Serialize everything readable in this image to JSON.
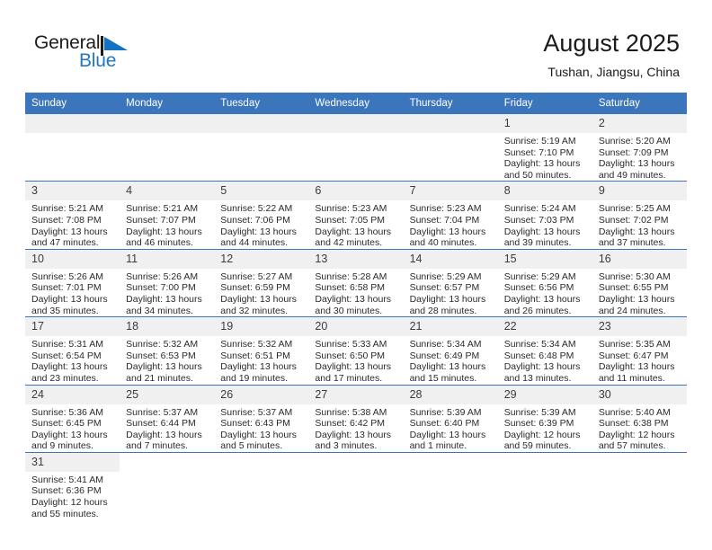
{
  "brand": {
    "name_part1": "General",
    "name_part2": "Blue",
    "flag_icon": "blue-triangle-flag-icon",
    "accent_color": "#2077c4"
  },
  "header": {
    "title": "August 2025",
    "subtitle": "Tushan, Jiangsu, China"
  },
  "theme": {
    "header_blue": "#3b76bc",
    "daynum_band": "#f0f0f0",
    "text": "#2a2a2a"
  },
  "calendar": {
    "weekday_headers": [
      "Sunday",
      "Monday",
      "Tuesday",
      "Wednesday",
      "Thursday",
      "Friday",
      "Saturday"
    ],
    "weeks": [
      [
        {
          "day": "",
          "sunrise": "",
          "sunset": "",
          "daylight_line1": "",
          "daylight_line2": ""
        },
        {
          "day": "",
          "sunrise": "",
          "sunset": "",
          "daylight_line1": "",
          "daylight_line2": ""
        },
        {
          "day": "",
          "sunrise": "",
          "sunset": "",
          "daylight_line1": "",
          "daylight_line2": ""
        },
        {
          "day": "",
          "sunrise": "",
          "sunset": "",
          "daylight_line1": "",
          "daylight_line2": ""
        },
        {
          "day": "",
          "sunrise": "",
          "sunset": "",
          "daylight_line1": "",
          "daylight_line2": ""
        },
        {
          "day": "1",
          "sunrise": "Sunrise: 5:19 AM",
          "sunset": "Sunset: 7:10 PM",
          "daylight_line1": "Daylight: 13 hours",
          "daylight_line2": "and 50 minutes."
        },
        {
          "day": "2",
          "sunrise": "Sunrise: 5:20 AM",
          "sunset": "Sunset: 7:09 PM",
          "daylight_line1": "Daylight: 13 hours",
          "daylight_line2": "and 49 minutes."
        }
      ],
      [
        {
          "day": "3",
          "sunrise": "Sunrise: 5:21 AM",
          "sunset": "Sunset: 7:08 PM",
          "daylight_line1": "Daylight: 13 hours",
          "daylight_line2": "and 47 minutes."
        },
        {
          "day": "4",
          "sunrise": "Sunrise: 5:21 AM",
          "sunset": "Sunset: 7:07 PM",
          "daylight_line1": "Daylight: 13 hours",
          "daylight_line2": "and 46 minutes."
        },
        {
          "day": "5",
          "sunrise": "Sunrise: 5:22 AM",
          "sunset": "Sunset: 7:06 PM",
          "daylight_line1": "Daylight: 13 hours",
          "daylight_line2": "and 44 minutes."
        },
        {
          "day": "6",
          "sunrise": "Sunrise: 5:23 AM",
          "sunset": "Sunset: 7:05 PM",
          "daylight_line1": "Daylight: 13 hours",
          "daylight_line2": "and 42 minutes."
        },
        {
          "day": "7",
          "sunrise": "Sunrise: 5:23 AM",
          "sunset": "Sunset: 7:04 PM",
          "daylight_line1": "Daylight: 13 hours",
          "daylight_line2": "and 40 minutes."
        },
        {
          "day": "8",
          "sunrise": "Sunrise: 5:24 AM",
          "sunset": "Sunset: 7:03 PM",
          "daylight_line1": "Daylight: 13 hours",
          "daylight_line2": "and 39 minutes."
        },
        {
          "day": "9",
          "sunrise": "Sunrise: 5:25 AM",
          "sunset": "Sunset: 7:02 PM",
          "daylight_line1": "Daylight: 13 hours",
          "daylight_line2": "and 37 minutes."
        }
      ],
      [
        {
          "day": "10",
          "sunrise": "Sunrise: 5:26 AM",
          "sunset": "Sunset: 7:01 PM",
          "daylight_line1": "Daylight: 13 hours",
          "daylight_line2": "and 35 minutes."
        },
        {
          "day": "11",
          "sunrise": "Sunrise: 5:26 AM",
          "sunset": "Sunset: 7:00 PM",
          "daylight_line1": "Daylight: 13 hours",
          "daylight_line2": "and 34 minutes."
        },
        {
          "day": "12",
          "sunrise": "Sunrise: 5:27 AM",
          "sunset": "Sunset: 6:59 PM",
          "daylight_line1": "Daylight: 13 hours",
          "daylight_line2": "and 32 minutes."
        },
        {
          "day": "13",
          "sunrise": "Sunrise: 5:28 AM",
          "sunset": "Sunset: 6:58 PM",
          "daylight_line1": "Daylight: 13 hours",
          "daylight_line2": "and 30 minutes."
        },
        {
          "day": "14",
          "sunrise": "Sunrise: 5:29 AM",
          "sunset": "Sunset: 6:57 PM",
          "daylight_line1": "Daylight: 13 hours",
          "daylight_line2": "and 28 minutes."
        },
        {
          "day": "15",
          "sunrise": "Sunrise: 5:29 AM",
          "sunset": "Sunset: 6:56 PM",
          "daylight_line1": "Daylight: 13 hours",
          "daylight_line2": "and 26 minutes."
        },
        {
          "day": "16",
          "sunrise": "Sunrise: 5:30 AM",
          "sunset": "Sunset: 6:55 PM",
          "daylight_line1": "Daylight: 13 hours",
          "daylight_line2": "and 24 minutes."
        }
      ],
      [
        {
          "day": "17",
          "sunrise": "Sunrise: 5:31 AM",
          "sunset": "Sunset: 6:54 PM",
          "daylight_line1": "Daylight: 13 hours",
          "daylight_line2": "and 23 minutes."
        },
        {
          "day": "18",
          "sunrise": "Sunrise: 5:32 AM",
          "sunset": "Sunset: 6:53 PM",
          "daylight_line1": "Daylight: 13 hours",
          "daylight_line2": "and 21 minutes."
        },
        {
          "day": "19",
          "sunrise": "Sunrise: 5:32 AM",
          "sunset": "Sunset: 6:51 PM",
          "daylight_line1": "Daylight: 13 hours",
          "daylight_line2": "and 19 minutes."
        },
        {
          "day": "20",
          "sunrise": "Sunrise: 5:33 AM",
          "sunset": "Sunset: 6:50 PM",
          "daylight_line1": "Daylight: 13 hours",
          "daylight_line2": "and 17 minutes."
        },
        {
          "day": "21",
          "sunrise": "Sunrise: 5:34 AM",
          "sunset": "Sunset: 6:49 PM",
          "daylight_line1": "Daylight: 13 hours",
          "daylight_line2": "and 15 minutes."
        },
        {
          "day": "22",
          "sunrise": "Sunrise: 5:34 AM",
          "sunset": "Sunset: 6:48 PM",
          "daylight_line1": "Daylight: 13 hours",
          "daylight_line2": "and 13 minutes."
        },
        {
          "day": "23",
          "sunrise": "Sunrise: 5:35 AM",
          "sunset": "Sunset: 6:47 PM",
          "daylight_line1": "Daylight: 13 hours",
          "daylight_line2": "and 11 minutes."
        }
      ],
      [
        {
          "day": "24",
          "sunrise": "Sunrise: 5:36 AM",
          "sunset": "Sunset: 6:45 PM",
          "daylight_line1": "Daylight: 13 hours",
          "daylight_line2": "and 9 minutes."
        },
        {
          "day": "25",
          "sunrise": "Sunrise: 5:37 AM",
          "sunset": "Sunset: 6:44 PM",
          "daylight_line1": "Daylight: 13 hours",
          "daylight_line2": "and 7 minutes."
        },
        {
          "day": "26",
          "sunrise": "Sunrise: 5:37 AM",
          "sunset": "Sunset: 6:43 PM",
          "daylight_line1": "Daylight: 13 hours",
          "daylight_line2": "and 5 minutes."
        },
        {
          "day": "27",
          "sunrise": "Sunrise: 5:38 AM",
          "sunset": "Sunset: 6:42 PM",
          "daylight_line1": "Daylight: 13 hours",
          "daylight_line2": "and 3 minutes."
        },
        {
          "day": "28",
          "sunrise": "Sunrise: 5:39 AM",
          "sunset": "Sunset: 6:40 PM",
          "daylight_line1": "Daylight: 13 hours",
          "daylight_line2": "and 1 minute."
        },
        {
          "day": "29",
          "sunrise": "Sunrise: 5:39 AM",
          "sunset": "Sunset: 6:39 PM",
          "daylight_line1": "Daylight: 12 hours",
          "daylight_line2": "and 59 minutes."
        },
        {
          "day": "30",
          "sunrise": "Sunrise: 5:40 AM",
          "sunset": "Sunset: 6:38 PM",
          "daylight_line1": "Daylight: 12 hours",
          "daylight_line2": "and 57 minutes."
        }
      ],
      [
        {
          "day": "31",
          "sunrise": "Sunrise: 5:41 AM",
          "sunset": "Sunset: 6:36 PM",
          "daylight_line1": "Daylight: 12 hours",
          "daylight_line2": "and 55 minutes."
        },
        {
          "day": "",
          "sunrise": "",
          "sunset": "",
          "daylight_line1": "",
          "daylight_line2": ""
        },
        {
          "day": "",
          "sunrise": "",
          "sunset": "",
          "daylight_line1": "",
          "daylight_line2": ""
        },
        {
          "day": "",
          "sunrise": "",
          "sunset": "",
          "daylight_line1": "",
          "daylight_line2": ""
        },
        {
          "day": "",
          "sunrise": "",
          "sunset": "",
          "daylight_line1": "",
          "daylight_line2": ""
        },
        {
          "day": "",
          "sunrise": "",
          "sunset": "",
          "daylight_line1": "",
          "daylight_line2": ""
        },
        {
          "day": "",
          "sunrise": "",
          "sunset": "",
          "daylight_line1": "",
          "daylight_line2": ""
        }
      ]
    ]
  }
}
